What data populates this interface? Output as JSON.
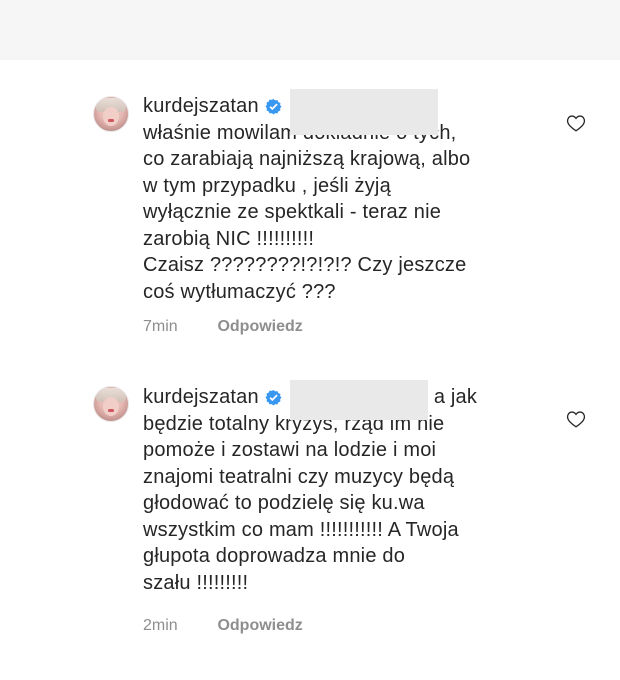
{
  "comments": [
    {
      "username": "kurdejszatan",
      "lines": [
        "właśnie mowilam dokładnie o tych,",
        "co zarabiają najniższą krajową, albo",
        "w tym przypadku , jeśli żyją",
        "wyłącznie ze spektkali - teraz nie",
        "zarobią NIC !!!!!!!!!!",
        "Czaisz ????????!?!?!? Czy jeszcze",
        "coś wytłumaczyć ???"
      ],
      "time": "7min",
      "reply_label": "Odpowiedz"
    },
    {
      "username": "kurdejszatan",
      "inline_tail": "a jak",
      "lines": [
        "będzie totalny kryzys, rząd im nie",
        "pomoże i zostawi na lodzie i moi",
        "znajomi teatralni czy muzycy będą",
        "głodować to podzielę się ku.wa",
        "wszystkim co mam !!!!!!!!!!! A Twoja",
        "głupota doprowadza mnie do",
        "szału !!!!!!!!!"
      ],
      "time": "2min",
      "reply_label": "Odpowiedz"
    }
  ],
  "icons": {
    "verified": "verified-badge-icon",
    "like": "heart-outline-icon",
    "avatar": "profile-avatar"
  },
  "colors": {
    "text": "#262626",
    "meta": "#8e8e8e",
    "verified": "#3897f0",
    "redaction": "#e9e9ea",
    "top_band": "#f6f6f6"
  }
}
